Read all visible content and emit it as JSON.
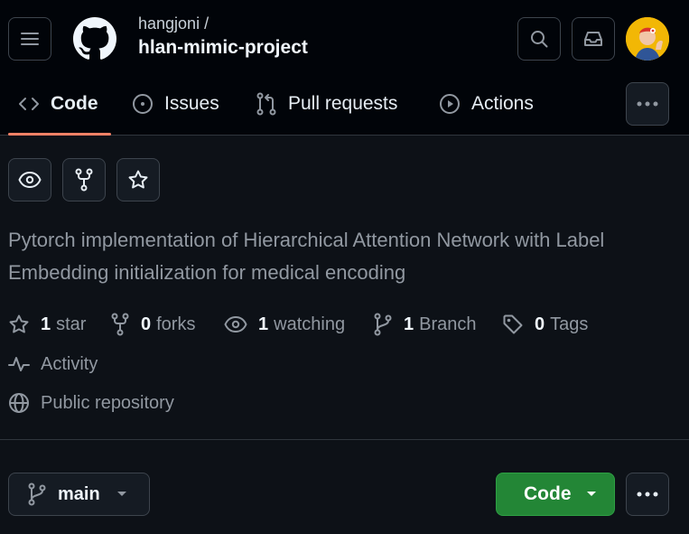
{
  "header": {
    "owner": "hangjoni /",
    "repo_name": "hlan-mimic-project"
  },
  "tabs": [
    {
      "label": "Code",
      "icon": "code-icon",
      "selected": true
    },
    {
      "label": "Issues",
      "icon": "issue-opened-icon"
    },
    {
      "label": "Pull requests",
      "icon": "git-pull-request-icon"
    },
    {
      "label": "Actions",
      "icon": "play-icon"
    }
  ],
  "about": {
    "description": "Pytorch implementation of Hierarchical Attention Network with Label Embedding initialization for medical encoding",
    "stats": [
      {
        "count": "1",
        "label": "star",
        "icon": "star-icon"
      },
      {
        "count": "0",
        "label": "forks",
        "icon": "repo-forked-icon"
      },
      {
        "count": "1",
        "label": "watching",
        "icon": "eye-icon"
      },
      {
        "count": "1",
        "label": "Branch",
        "icon": "git-branch-icon"
      },
      {
        "count": "0",
        "label": "Tags",
        "icon": "tag-icon"
      }
    ],
    "activity_label": "Activity",
    "visibility_label": "Public repository"
  },
  "toolbar": {
    "branch_label": "main",
    "code_button_label": "Code"
  },
  "colors": {
    "background": "#0d1117",
    "header_background": "#010409",
    "accent_underline": "#f78166",
    "code_button": "#238636",
    "muted_text": "#9198a1"
  }
}
